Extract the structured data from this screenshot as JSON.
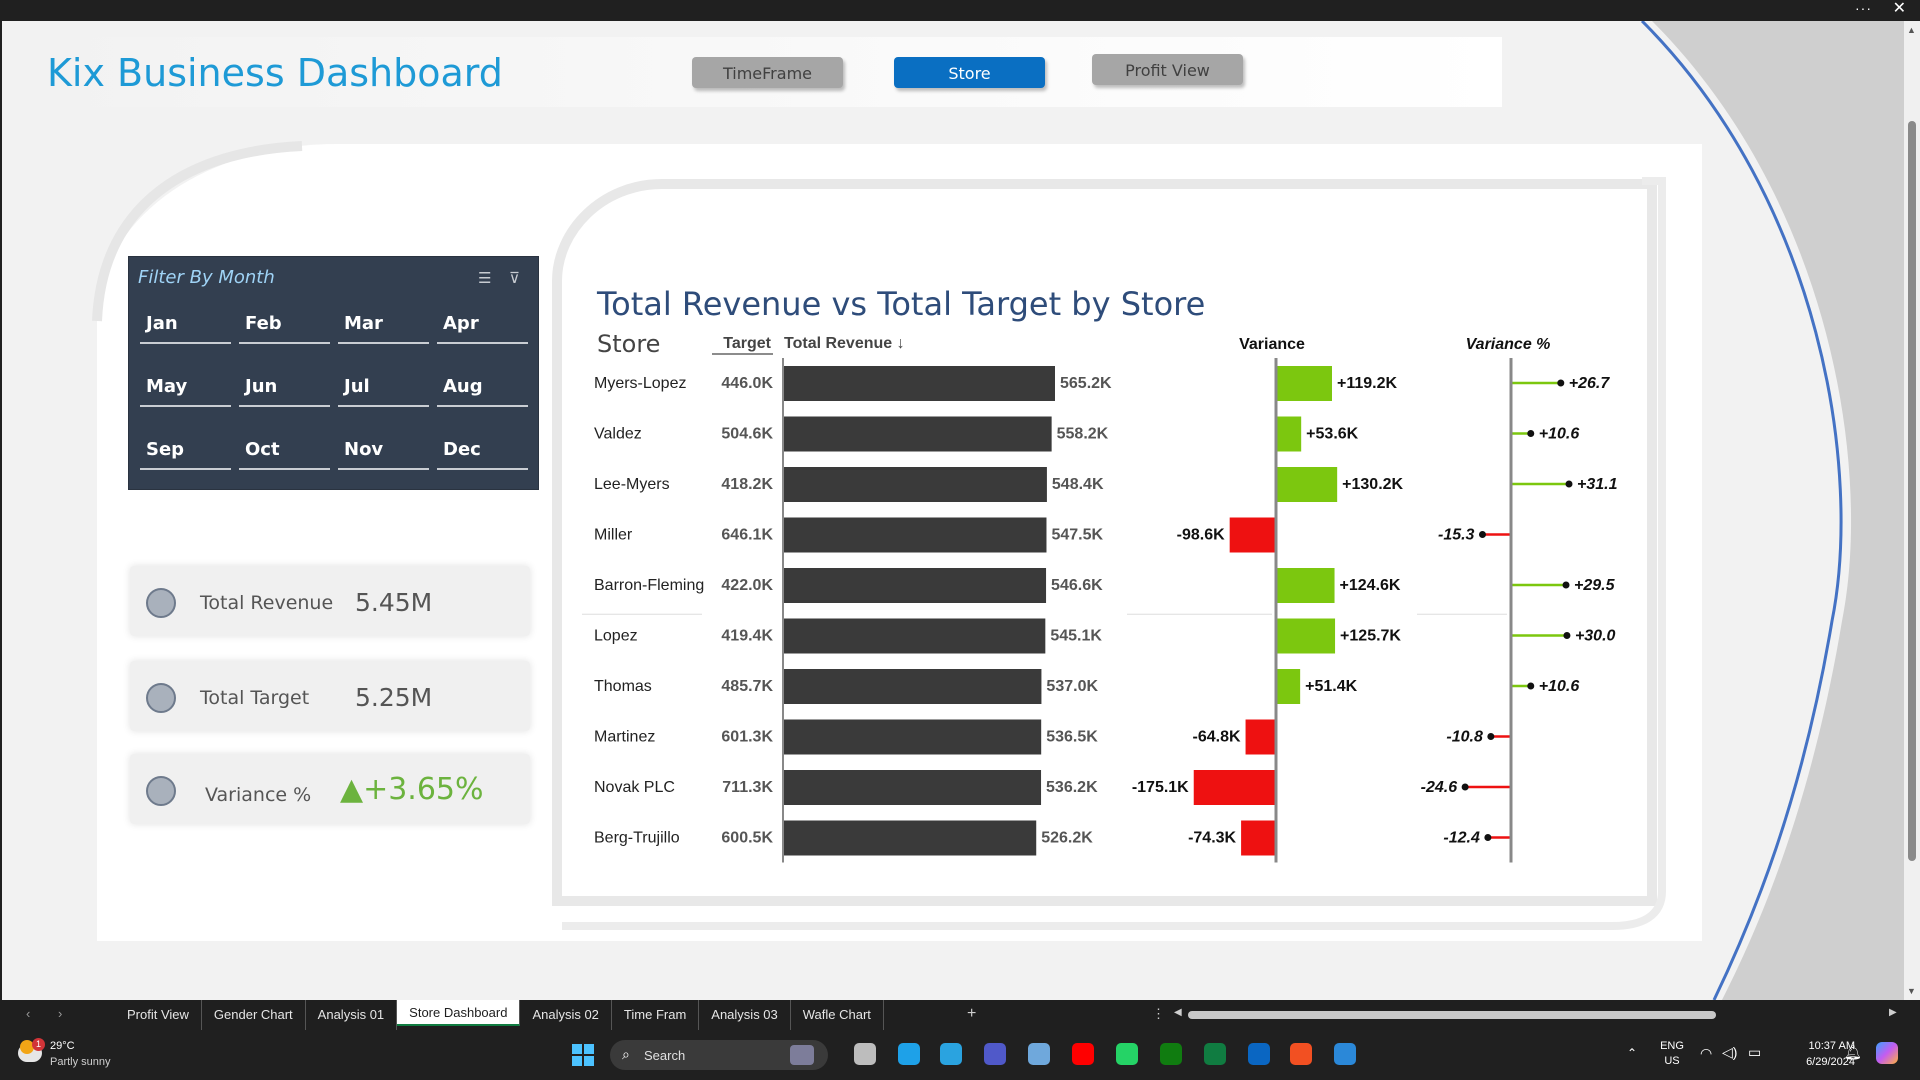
{
  "app": {
    "title": "Kix Business Dashboard"
  },
  "nav": {
    "timeframe": "TimeFrame",
    "store": "Store",
    "profit_view": "Profit View"
  },
  "filter": {
    "title": "Filter By Month",
    "months": [
      "Jan",
      "Feb",
      "Mar",
      "Apr",
      "May",
      "Jun",
      "Jul",
      "Aug",
      "Sep",
      "Oct",
      "Nov",
      "Dec"
    ]
  },
  "kpis": [
    {
      "label": "Total Revenue",
      "value": "5.45M"
    },
    {
      "label": "Total Target",
      "value": "5.25M"
    },
    {
      "label": "Variance %",
      "value": "+3.65%",
      "indicator": "▲"
    }
  ],
  "colors": {
    "accent": "#1e9ad6",
    "bar": "#3a3a3a",
    "positive": "#7cc70f",
    "negative": "#ee1111",
    "panel": "#333f50"
  },
  "chart_data": {
    "type": "table",
    "title": "Total Revenue vs Total Target by Store",
    "headers": {
      "store": "Store",
      "target": "Target",
      "revenue": "Total Revenue ↓",
      "variance": "Variance",
      "variance_pct": "Variance %"
    },
    "rows": [
      {
        "store": "Myers-Lopez",
        "target_label": "446.0K",
        "revenue": 565.2,
        "revenue_label": "565.2K",
        "variance": 119.2,
        "variance_label": "+119.2K",
        "variance_pct": 26.7,
        "variance_pct_label": "+26.7"
      },
      {
        "store": "Valdez",
        "target_label": "504.6K",
        "revenue": 558.2,
        "revenue_label": "558.2K",
        "variance": 53.6,
        "variance_label": "+53.6K",
        "variance_pct": 10.6,
        "variance_pct_label": "+10.6"
      },
      {
        "store": "Lee-Myers",
        "target_label": "418.2K",
        "revenue": 548.4,
        "revenue_label": "548.4K",
        "variance": 130.2,
        "variance_label": "+130.2K",
        "variance_pct": 31.1,
        "variance_pct_label": "+31.1"
      },
      {
        "store": "Miller",
        "target_label": "646.1K",
        "revenue": 547.5,
        "revenue_label": "547.5K",
        "variance": -98.6,
        "variance_label": "-98.6K",
        "variance_pct": -15.3,
        "variance_pct_label": "-15.3"
      },
      {
        "store": "Barron-Fleming",
        "target_label": "422.0K",
        "revenue": 546.6,
        "revenue_label": "546.6K",
        "variance": 124.6,
        "variance_label": "+124.6K",
        "variance_pct": 29.5,
        "variance_pct_label": "+29.5"
      },
      {
        "store": "Lopez",
        "target_label": "419.4K",
        "revenue": 545.1,
        "revenue_label": "545.1K",
        "variance": 125.7,
        "variance_label": "+125.7K",
        "variance_pct": 30.0,
        "variance_pct_label": "+30.0"
      },
      {
        "store": "Thomas",
        "target_label": "485.7K",
        "revenue": 537.0,
        "revenue_label": "537.0K",
        "variance": 51.4,
        "variance_label": "+51.4K",
        "variance_pct": 10.6,
        "variance_pct_label": "+10.6"
      },
      {
        "store": "Martinez",
        "target_label": "601.3K",
        "revenue": 536.5,
        "revenue_label": "536.5K",
        "variance": -64.8,
        "variance_label": "-64.8K",
        "variance_pct": -10.8,
        "variance_pct_label": "-10.8"
      },
      {
        "store": "Novak PLC",
        "target_label": "711.3K",
        "revenue": 536.2,
        "revenue_label": "536.2K",
        "variance": -175.1,
        "variance_label": "-175.1K",
        "variance_pct": -24.6,
        "variance_pct_label": "-24.6"
      },
      {
        "store": "Berg-Trujillo",
        "target_label": "600.5K",
        "revenue": 526.2,
        "revenue_label": "526.2K",
        "variance": -74.3,
        "variance_label": "-74.3K",
        "variance_pct": -12.4,
        "variance_pct_label": "-12.4"
      }
    ]
  },
  "sheet_tabs": [
    "Profit View",
    "Gender Chart",
    "Analysis 01",
    "Store Dashboard",
    "Analysis 02",
    "Time Fram",
    "Analysis 03",
    "Wafle Chart"
  ],
  "active_sheet": "Store Dashboard",
  "taskbar": {
    "weather_temp": "29°C",
    "weather_desc": "Partly sunny",
    "weather_badge": "1",
    "search_placeholder": "Search",
    "lang_top": "ENG",
    "lang_bottom": "US",
    "time": "10:37 AM",
    "date": "6/29/2024"
  }
}
